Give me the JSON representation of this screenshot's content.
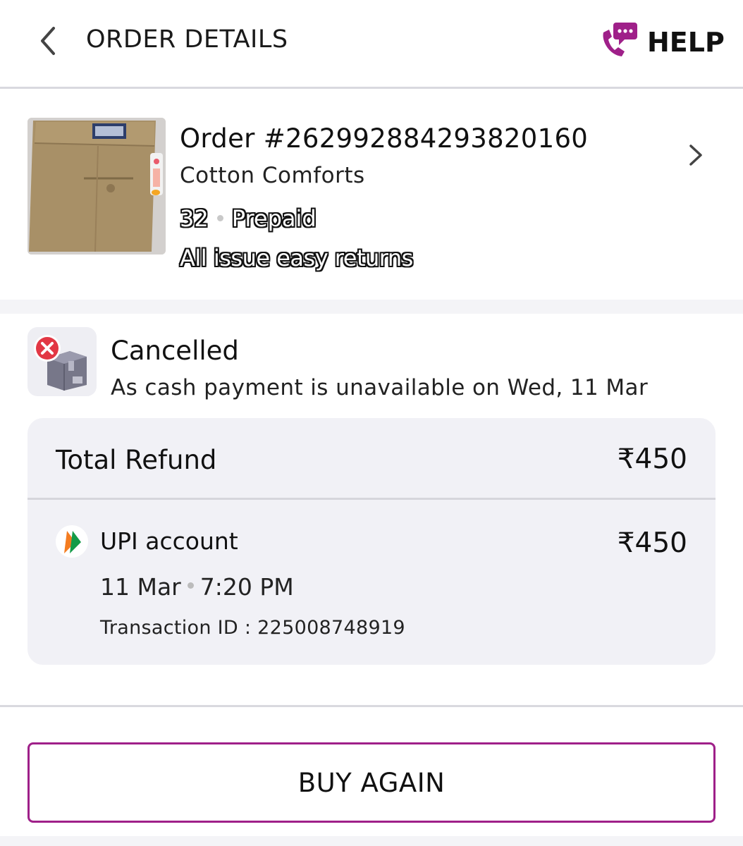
{
  "header": {
    "title": "ORDER DETAILS",
    "help_label": "HELP",
    "back_icon": "chevron-left-icon",
    "help_icon": "phone-chat-icon",
    "accent_color": "#9f2089"
  },
  "product": {
    "order_number": "Order #262992884293820160",
    "name": "Cotton Comforts",
    "size": "32",
    "payment": "Prepaid",
    "returns_note": "All issue easy returns",
    "image": "khaki-trousers-image"
  },
  "status": {
    "title": "Cancelled",
    "message": "As cash payment is unavailable on Wed, 11 Mar",
    "icon": "cancelled-package-icon",
    "color": "#e23744"
  },
  "refund": {
    "total_label": "Total Refund",
    "total_amount": "₹450",
    "method_label": "UPI account",
    "method_amount": "₹450",
    "date": "11 Mar",
    "time": "7:20 PM",
    "transaction": "Transaction ID : 225008748919",
    "method_icon": "upi-logo-icon"
  },
  "actions": {
    "buy_again": "BUY AGAIN"
  }
}
